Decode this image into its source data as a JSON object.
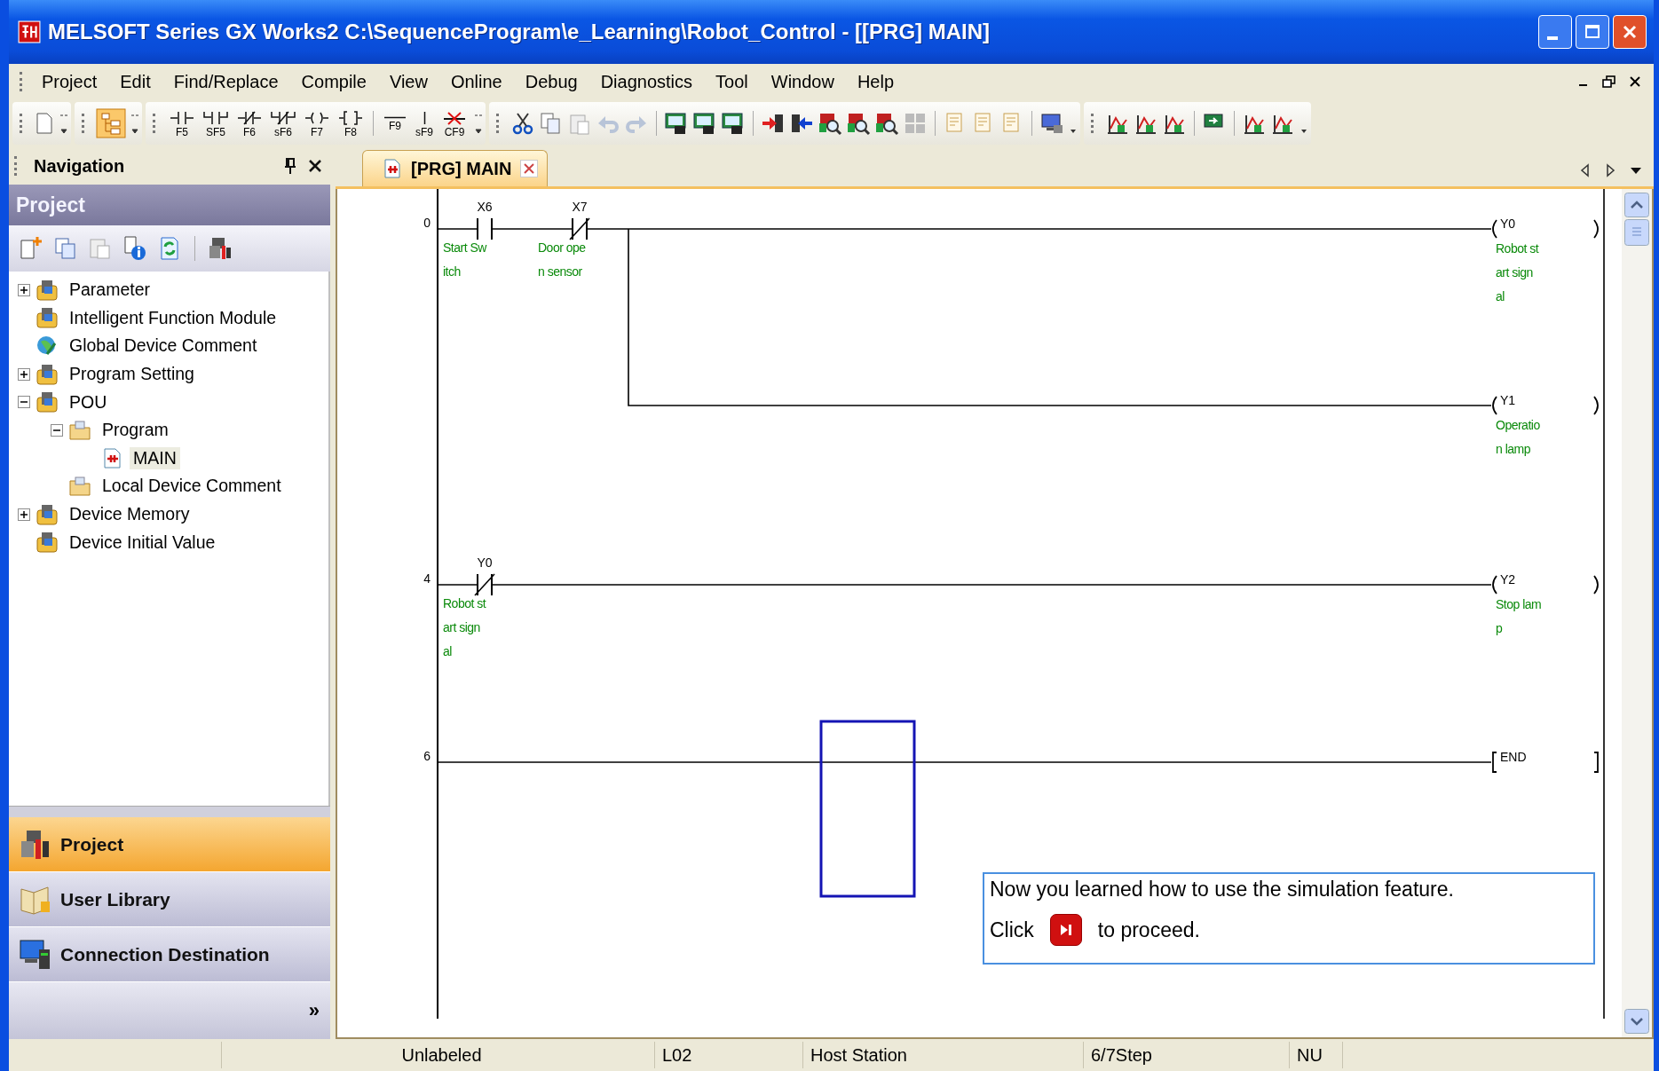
{
  "window": {
    "title": "MELSOFT Series GX Works2 C:\\SequenceProgram\\e_Learning\\Robot_Control - [[PRG] MAIN]"
  },
  "menu": [
    "Project",
    "Edit",
    "Find/Replace",
    "Compile",
    "View",
    "Online",
    "Debug",
    "Diagnostics",
    "Tool",
    "Window",
    "Help"
  ],
  "toolbar": {
    "ladder_keys": [
      {
        "label": "F5",
        "kind": "contact"
      },
      {
        "label": "SF5",
        "kind": "parallel_contact"
      },
      {
        "label": "F6",
        "kind": "nc_contact"
      },
      {
        "label": "sF6",
        "kind": "parallel_nc_contact"
      },
      {
        "label": "F7",
        "kind": "coil"
      },
      {
        "label": "F8",
        "kind": "instruction"
      },
      {
        "label": "F9",
        "kind": "hline"
      },
      {
        "label": "sF9",
        "kind": "vline"
      },
      {
        "label": "CF9",
        "kind": "delete_line"
      }
    ]
  },
  "navigation": {
    "title": "Navigation",
    "section": "Project",
    "tree": [
      {
        "label": "Parameter",
        "kind": "package",
        "expanded": false,
        "selected": false
      },
      {
        "label": "Intelligent Function Module",
        "kind": "package",
        "selected": false
      },
      {
        "label": "Global Device Comment",
        "kind": "globe",
        "selected": false
      },
      {
        "label": "Program Setting",
        "kind": "package",
        "expanded": false,
        "selected": false
      },
      {
        "label": "POU",
        "kind": "package",
        "expanded": true,
        "selected": false,
        "children": [
          {
            "label": "Program",
            "kind": "folder",
            "expanded": true,
            "selected": false,
            "children": [
              {
                "label": "MAIN",
                "kind": "program",
                "selected": true
              }
            ]
          },
          {
            "label": "Local Device Comment",
            "kind": "folder",
            "selected": false
          }
        ]
      },
      {
        "label": "Device Memory",
        "kind": "package",
        "expanded": false,
        "selected": false
      },
      {
        "label": "Device Initial Value",
        "kind": "package",
        "selected": false
      }
    ],
    "views": [
      {
        "label": "Project",
        "selected": true
      },
      {
        "label": "User Library",
        "selected": false
      },
      {
        "label": "Connection Destination",
        "selected": false
      }
    ],
    "more": "»"
  },
  "editor": {
    "tab": "[PRG] MAIN",
    "rungs": [
      {
        "step": "0",
        "contacts": [
          {
            "device": "X6",
            "kind": "no",
            "comment": [
              "Start Sw",
              "itch"
            ]
          },
          {
            "device": "X7",
            "kind": "nc",
            "comment": [
              "Door ope",
              "n sensor"
            ]
          }
        ],
        "outputs": [
          {
            "device": "Y0",
            "kind": "coil",
            "comment": [
              "Robot st",
              "art sign",
              "al"
            ]
          },
          {
            "device": "Y1",
            "kind": "coil",
            "comment": [
              "Operatio",
              "n lamp"
            ]
          }
        ]
      },
      {
        "step": "4",
        "contacts": [
          {
            "device": "Y0",
            "kind": "nc",
            "comment": [
              "Robot st",
              "art sign",
              "al"
            ]
          }
        ],
        "outputs": [
          {
            "device": "Y2",
            "kind": "coil",
            "comment": [
              "Stop lam",
              "p"
            ]
          }
        ]
      },
      {
        "step": "6",
        "outputs": [
          {
            "device": "END",
            "kind": "instruction"
          }
        ]
      }
    ],
    "tooltip": {
      "message": "Now you learned how to use the simulation feature.",
      "before": "Click",
      "after": "to proceed."
    }
  },
  "status_bar": [
    "Unlabeled",
    "L02",
    "Host Station",
    "6/7Step",
    "NU"
  ]
}
